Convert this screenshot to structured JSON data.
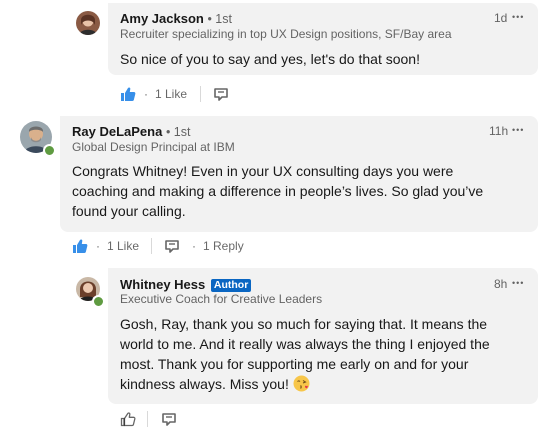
{
  "colors": {
    "bubble_bg": "#f2f2f2",
    "author_badge_bg": "#0a66c2",
    "like_blue": "#378fe9",
    "online_green": "#5f9b41"
  },
  "comments": [
    {
      "name": "Amy Jackson",
      "degree": "• 1st",
      "headline": "Recruiter specializing in top UX Design positions, SF/Bay area",
      "time": "1d",
      "more": "•••",
      "text": "So nice of you to say and yes, let's do that soon!",
      "like_count": "1 Like",
      "dot": "·",
      "icons": [
        "like-filled-icon",
        "reply-icon"
      ]
    },
    {
      "name": "Ray DeLaPena",
      "degree": "• 1st",
      "headline": "Global Design Principal at IBM",
      "time": "11h",
      "more": "•••",
      "text_lines": [
        "Congrats Whitney! Even in your UX consulting days you were",
        "coaching and making a difference in people’s lives. So glad you’ve",
        "found your calling."
      ],
      "like_count": "1 Like",
      "reply_count": "1 Reply",
      "dot": "·",
      "icons": [
        "like-filled-icon",
        "reply-icon"
      ]
    },
    {
      "name": "Whitney Hess",
      "badge": "Author",
      "headline": "Executive Coach for Creative Leaders",
      "time": "8h",
      "more": "•••",
      "text_lines": [
        "Gosh, Ray, thank you so much for saying that. It means the",
        "world to me. And it really was always the thing I enjoyed the",
        "most. Thank you for supporting me early on and for your",
        "kindness always. Miss you!"
      ],
      "emoji": "face-blowing-kiss-emoji",
      "icons": [
        "like-outline-icon",
        "reply-icon"
      ]
    }
  ]
}
